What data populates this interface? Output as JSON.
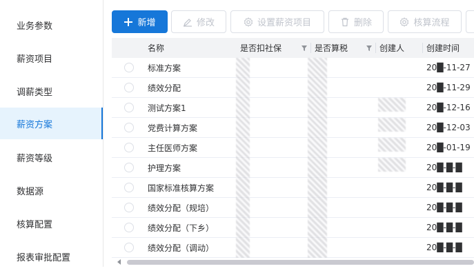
{
  "sidebar": {
    "items": [
      {
        "label": "业务参数"
      },
      {
        "label": "薪资项目"
      },
      {
        "label": "调薪类型"
      },
      {
        "label": "薪资方案",
        "active": true
      },
      {
        "label": "薪资等级"
      },
      {
        "label": "数据源"
      },
      {
        "label": "核算配置"
      },
      {
        "label": "报表审批配置"
      }
    ]
  },
  "toolbar": {
    "add_label": "新增",
    "edit_label": "修改",
    "set_items_label": "设置薪资项目",
    "delete_label": "删除",
    "calc_flow_label": "核算流程"
  },
  "table": {
    "columns": {
      "name": "名称",
      "social": "是否扣社保",
      "tax": "是否算税",
      "creator": "创建人",
      "created_time": "创建时间"
    },
    "rows": [
      {
        "name": "标准方案",
        "time": "20█-11-27"
      },
      {
        "name": "绩效分配",
        "time": "20█-11-29"
      },
      {
        "name": "测试方案1",
        "time": "20█-12-16"
      },
      {
        "name": "党费计算方案",
        "time": "20█-12-03"
      },
      {
        "name": "主任医师方案",
        "time": "20█-01-19"
      },
      {
        "name": "护理方案",
        "time": "20█-█-█"
      },
      {
        "name": "国家标准核算方案",
        "time": "20█-█-█"
      },
      {
        "name": "绩效分配（规培）",
        "time": "20█-█-█"
      },
      {
        "name": "绩效分配（下乡）",
        "time": "20█-█-█"
      },
      {
        "name": "绩效分配（调动）",
        "time": "20█-█-█"
      }
    ]
  },
  "colors": {
    "primary": "#1677d9",
    "active_bg": "#e6f3fd",
    "header_bg": "#f2f3f5"
  }
}
